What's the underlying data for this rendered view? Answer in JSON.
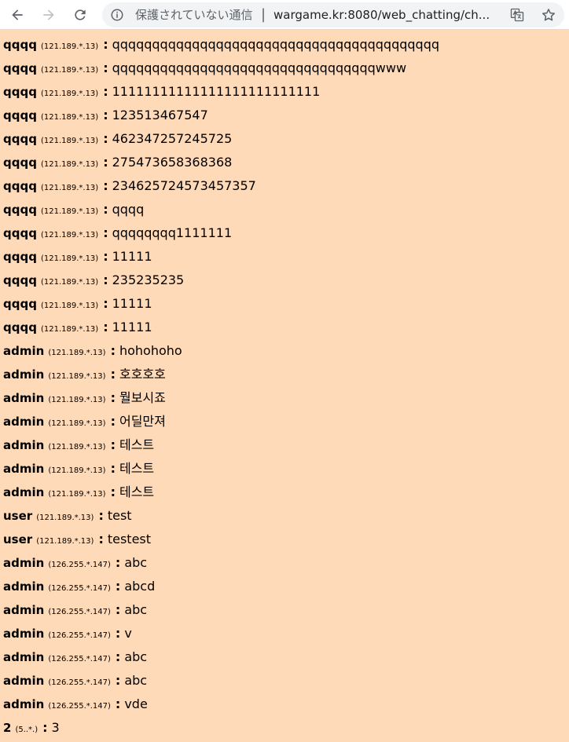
{
  "browser": {
    "security_warning": "保護されていない通信",
    "separator": "|",
    "url": "wargame.kr:8080/web_chatting/ch...",
    "colors": {
      "toolbar": "#ffffff",
      "omnibox": "#f1f3f4",
      "icon": "#5f6368"
    },
    "icons": [
      "back-icon",
      "forward-icon",
      "reload-icon",
      "info-icon",
      "translate-icon",
      "star-icon"
    ]
  },
  "page": {
    "background": "#ffdab9"
  },
  "chat": {
    "messages": [
      {
        "nick": "qqqq",
        "ip": "(121.189.*.13)",
        "text": "qqqqqqqqqqqqqqqqqqqqqqqqqqqqqqqqqqqqqqqqq"
      },
      {
        "nick": "qqqq",
        "ip": "(121.189.*.13)",
        "text": "qqqqqqqqqqqqqqqqqqqqqqqqqqqqqqqqqwww"
      },
      {
        "nick": "qqqq",
        "ip": "(121.189.*.13)",
        "text": "11111111111111111111111111"
      },
      {
        "nick": "qqqq",
        "ip": "(121.189.*.13)",
        "text": "123513467547"
      },
      {
        "nick": "qqqq",
        "ip": "(121.189.*.13)",
        "text": "462347257245725"
      },
      {
        "nick": "qqqq",
        "ip": "(121.189.*.13)",
        "text": "275473658368368"
      },
      {
        "nick": "qqqq",
        "ip": "(121.189.*.13)",
        "text": "234625724573457357"
      },
      {
        "nick": "qqqq",
        "ip": "(121.189.*.13)",
        "text": "qqqq"
      },
      {
        "nick": "qqqq",
        "ip": "(121.189.*.13)",
        "text": "qqqqqqqq1111111"
      },
      {
        "nick": "qqqq",
        "ip": "(121.189.*.13)",
        "text": "11111"
      },
      {
        "nick": "qqqq",
        "ip": "(121.189.*.13)",
        "text": "235235235"
      },
      {
        "nick": "qqqq",
        "ip": "(121.189.*.13)",
        "text": "11111"
      },
      {
        "nick": "qqqq",
        "ip": "(121.189.*.13)",
        "text": "11111"
      },
      {
        "nick": "admin",
        "ip": "(121.189.*.13)",
        "text": "hohohoho"
      },
      {
        "nick": "admin",
        "ip": "(121.189.*.13)",
        "text": "호호호호"
      },
      {
        "nick": "admin",
        "ip": "(121.189.*.13)",
        "text": "뭘보시죠"
      },
      {
        "nick": "admin",
        "ip": "(121.189.*.13)",
        "text": "어딜만져"
      },
      {
        "nick": "admin",
        "ip": "(121.189.*.13)",
        "text": "테스트"
      },
      {
        "nick": "admin",
        "ip": "(121.189.*.13)",
        "text": "테스트"
      },
      {
        "nick": "admin",
        "ip": "(121.189.*.13)",
        "text": "테스트"
      },
      {
        "nick": "user",
        "ip": "(121.189.*.13)",
        "text": "test"
      },
      {
        "nick": "user",
        "ip": "(121.189.*.13)",
        "text": "testest"
      },
      {
        "nick": "admin",
        "ip": "(126.255.*.147)",
        "text": "abc"
      },
      {
        "nick": "admin",
        "ip": "(126.255.*.147)",
        "text": "abcd"
      },
      {
        "nick": "admin",
        "ip": "(126.255.*.147)",
        "text": "abc"
      },
      {
        "nick": "admin",
        "ip": "(126.255.*.147)",
        "text": "v"
      },
      {
        "nick": "admin",
        "ip": "(126.255.*.147)",
        "text": "abc"
      },
      {
        "nick": "admin",
        "ip": "(126.255.*.147)",
        "text": "abc"
      },
      {
        "nick": "admin",
        "ip": "(126.255.*.147)",
        "text": "vde"
      },
      {
        "nick": "2",
        "ip": "(5..*.)",
        "text": "3"
      }
    ],
    "colon": ":"
  }
}
